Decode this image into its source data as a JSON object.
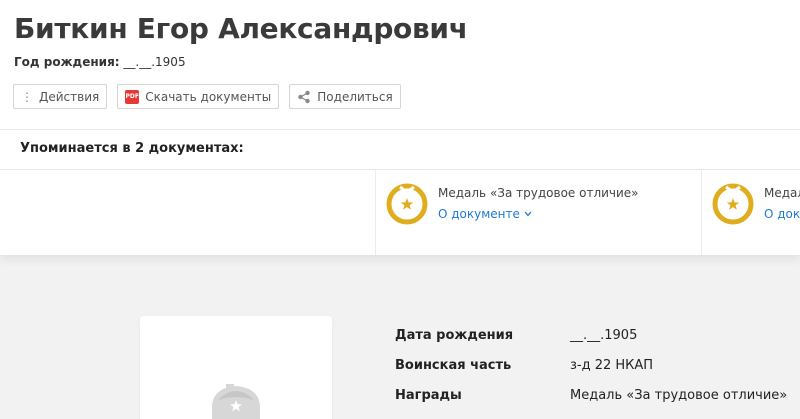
{
  "person": {
    "name": "Биткин Егор Александрович",
    "birth_label": "Год рождения:",
    "birth_value": "__.__.1905"
  },
  "actions": {
    "actions_label": "Действия",
    "download_label": "Скачать документы",
    "pdf_badge": "PDF",
    "share_label": "Поделиться"
  },
  "mentions": {
    "heading": "Упоминается в 2 документах:",
    "docs": [
      {
        "title": "Медаль «За трудовое отличие»",
        "link": "О документе"
      },
      {
        "title": "Медаль «За трудовое отличие»",
        "link": "О документе"
      }
    ]
  },
  "details": {
    "rows": [
      {
        "key": "Дата рождения",
        "value": "__.__.1905"
      },
      {
        "key": "Воинская часть",
        "value": "з-д 22 НКАП"
      },
      {
        "key": "Награды",
        "value": "Медаль «За трудовое отличие»"
      }
    ]
  },
  "colors": {
    "medal": "#e0ad1f",
    "link": "#1e7ad8",
    "pdf": "#e53935"
  },
  "icons": [
    "more-vertical-icon",
    "pdf-icon",
    "share-icon",
    "medal-icon",
    "chevron-down-icon",
    "soldier-placeholder-icon"
  ]
}
